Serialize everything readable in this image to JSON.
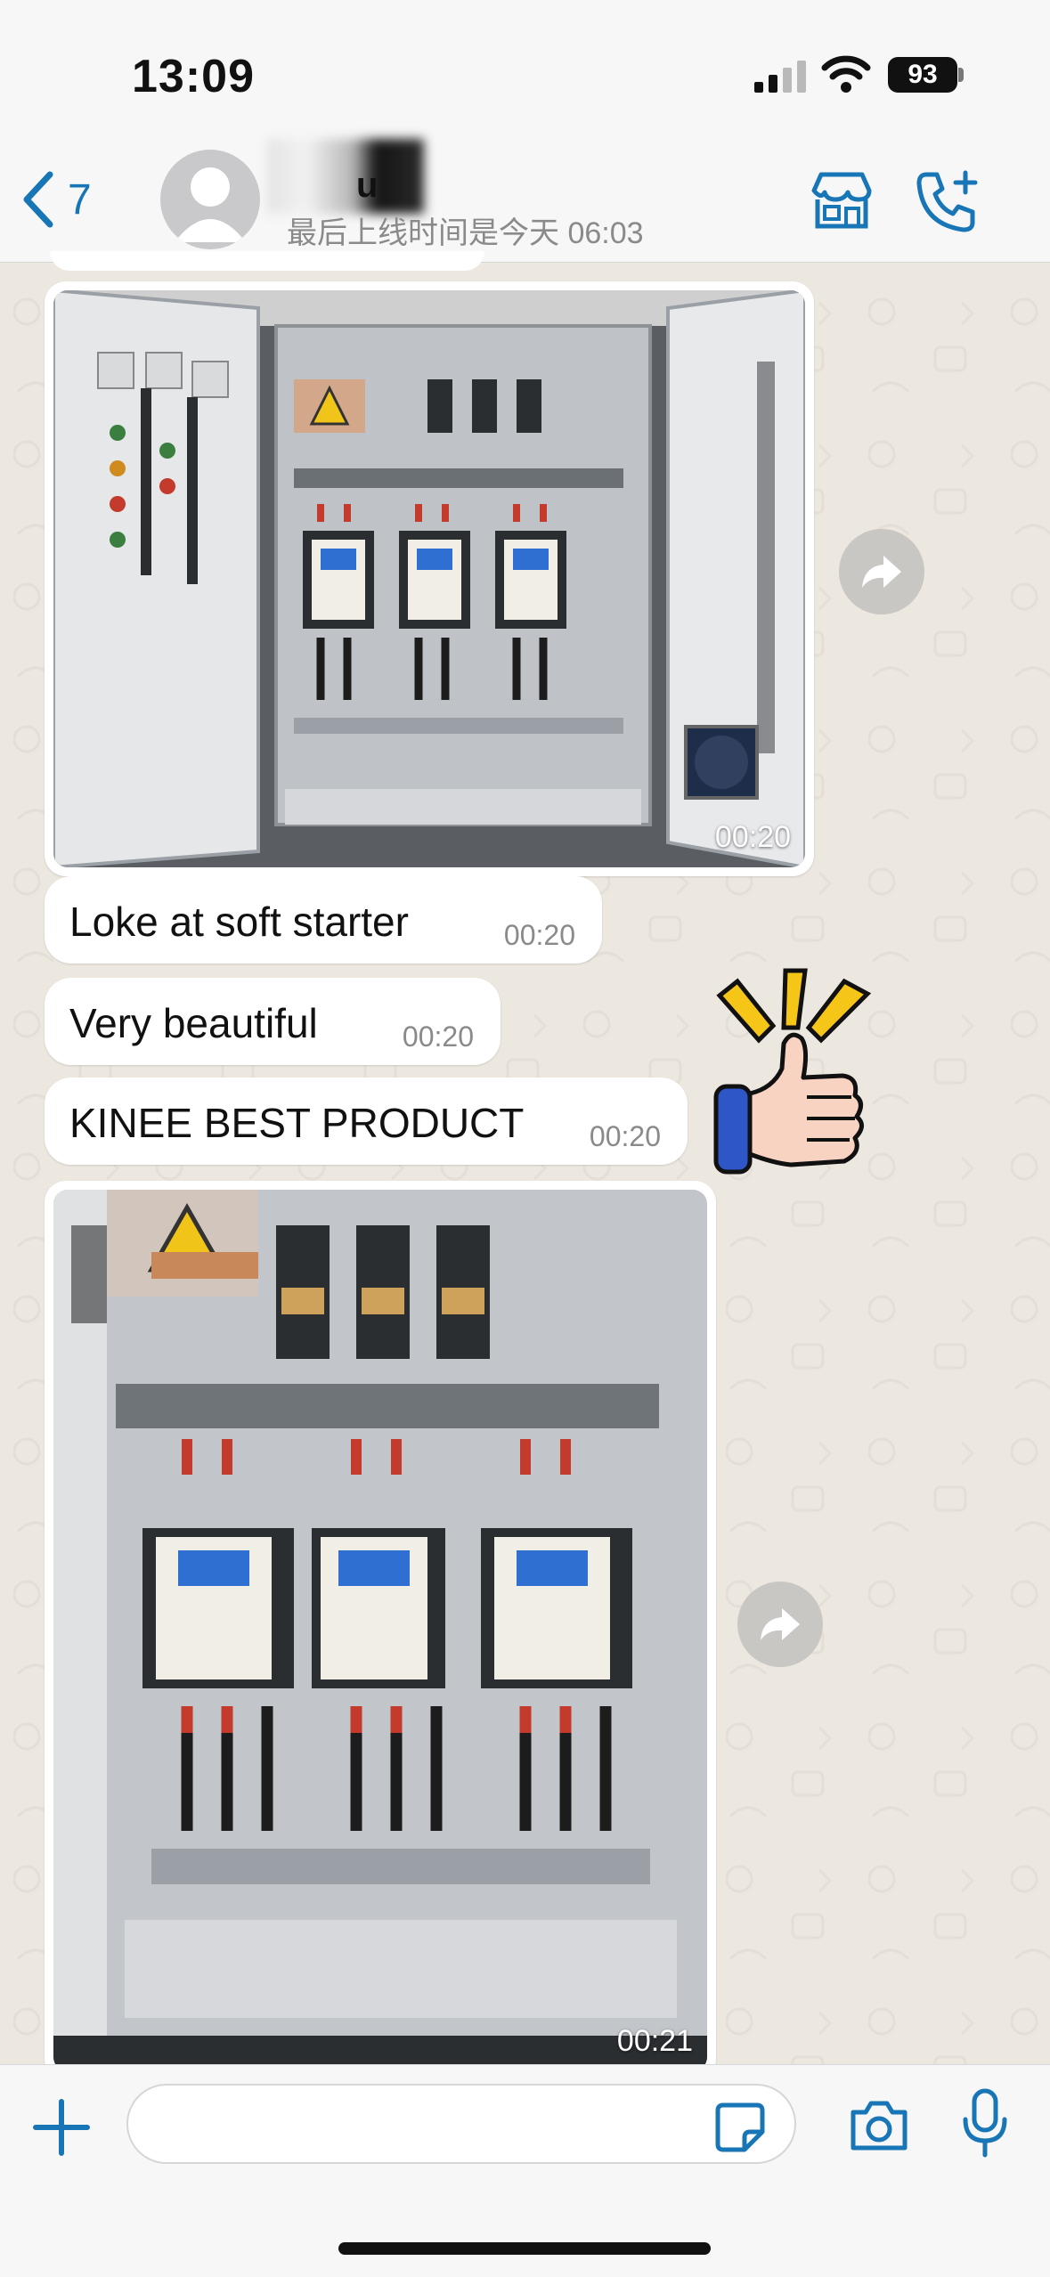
{
  "status_bar": {
    "time": "13:09",
    "battery": "93"
  },
  "header": {
    "back_count": "7",
    "contact_name_visible": "u",
    "last_seen": "最后上线时间是今天 06:03",
    "icons": [
      "chevron-left-icon",
      "avatar-placeholder-icon",
      "shop-icon",
      "call-add-icon"
    ]
  },
  "messages": [
    {
      "type": "image",
      "time": "00:20",
      "description_icon": "electrical-cabinet-photo"
    },
    {
      "type": "text",
      "text": "Loke at soft starter",
      "time": "00:20"
    },
    {
      "type": "text",
      "text": "Very beautiful",
      "time": "00:20"
    },
    {
      "type": "text",
      "text": "KINEE BEST PRODUCT",
      "time": "00:20"
    },
    {
      "type": "image",
      "time": "00:21",
      "description_icon": "electrical-cabinet-photo"
    }
  ],
  "composer": {
    "placeholder": "",
    "icons": [
      "plus-icon",
      "sticker-icon",
      "camera-icon",
      "microphone-icon"
    ]
  },
  "colors": {
    "accent": "#1876b7",
    "chat_bg": "#ece7df",
    "bubble": "#ffffff"
  }
}
